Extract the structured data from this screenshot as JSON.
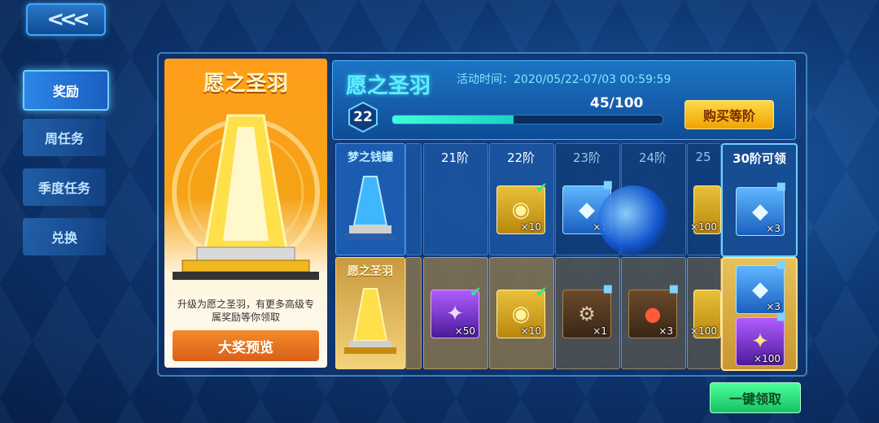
{
  "nav": {
    "back_label": "<<<"
  },
  "side_tabs": [
    {
      "label": "奖励",
      "active": true
    },
    {
      "label": "周任务",
      "active": false
    },
    {
      "label": "季度任务",
      "active": false
    },
    {
      "label": "兑换",
      "active": false
    }
  ],
  "promo": {
    "title": "愿之圣羽",
    "desc": "升级为愿之圣羽，有更多高级专属奖励等你领取",
    "preview_button": "大奖预览"
  },
  "header": {
    "title": "愿之圣羽",
    "activity_time": "活动时间：2020/05/22-07/03 00:59:59",
    "level": "22",
    "progress_text": "45/100",
    "progress_fraction": 0.45,
    "buy_button": "购买等阶"
  },
  "row_labels": {
    "top": "梦之钱罐",
    "bottom": "愿之圣羽"
  },
  "tiers": [
    {
      "label": "21阶"
    },
    {
      "label": "22阶"
    },
    {
      "label": "23阶"
    },
    {
      "label": "24阶"
    },
    {
      "label": "25"
    }
  ],
  "rewards_top": [
    {
      "qty": "",
      "icon": "gold-coin-icon",
      "claimed": false,
      "locked": false
    },
    {
      "qty": "×10",
      "icon": "gold-coin-icon",
      "claimed": true,
      "locked": false
    },
    {
      "qty": "×1",
      "icon": "blue-crystal-icon",
      "claimed": false,
      "locked": true
    },
    {
      "qty": "",
      "icon": "blue-orb-icon",
      "claimed": false,
      "locked": false
    },
    {
      "qty": "×100",
      "icon": "gold-coin-icon",
      "claimed": false,
      "locked": false
    }
  ],
  "rewards_bottom": [
    {
      "qty": "×50",
      "icon": "purple-feather-icon",
      "claimed": true,
      "locked": false
    },
    {
      "qty": "×10",
      "icon": "gold-coin-icon",
      "claimed": true,
      "locked": false
    },
    {
      "qty": "×1",
      "icon": "robot-icon",
      "claimed": false,
      "locked": true
    },
    {
      "qty": "×3",
      "icon": "red-pouch-icon",
      "claimed": false,
      "locked": true
    },
    {
      "qty": "×100",
      "icon": "gold-coin-icon",
      "claimed": false,
      "locked": false
    }
  ],
  "final_tier": {
    "label": "30阶可领",
    "top_qty": "×3",
    "bottom_qty_1": "×3",
    "bottom_qty_2": "×100"
  },
  "claim_all_button": "一键领取",
  "colors": {
    "accent_cyan": "#5cf0ff",
    "buy_yellow": "#ffd84a",
    "claim_green": "#4cff9a",
    "promo_orange": "#f48a2a"
  }
}
